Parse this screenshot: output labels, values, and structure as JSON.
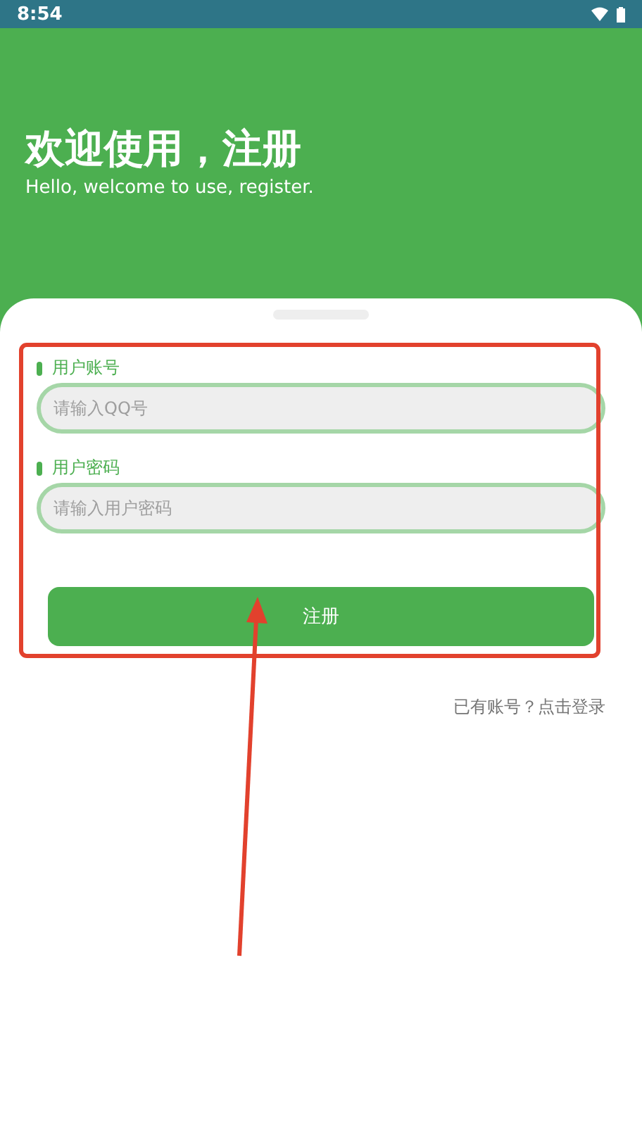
{
  "status_bar": {
    "time": "8:54"
  },
  "header": {
    "title": "欢迎使用，注册",
    "subtitle": "Hello, welcome to use, register."
  },
  "form": {
    "fields": [
      {
        "label": "用户账号",
        "placeholder": "请输入QQ号"
      },
      {
        "label": "用户密码",
        "placeholder": "请输入用户密码"
      }
    ],
    "submit": "注册",
    "login_link": "已有账号？点击登录"
  }
}
